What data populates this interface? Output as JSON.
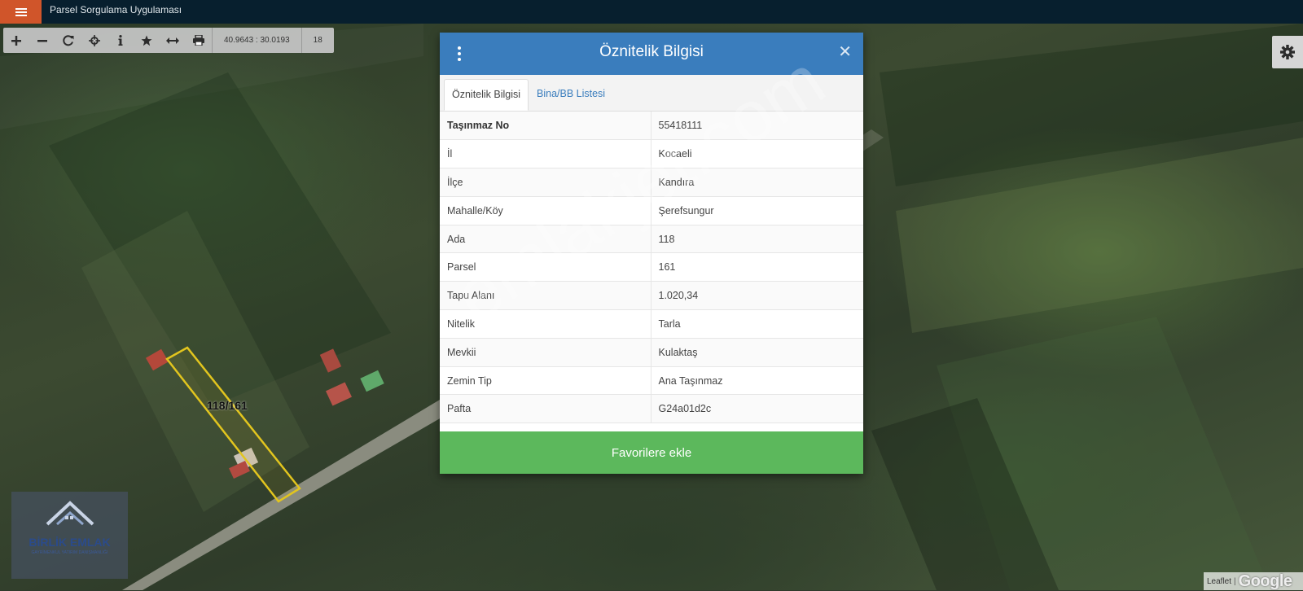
{
  "topbar": {
    "title": "Parsel Sorgulama Uygulaması"
  },
  "toolbar": {
    "tools": [
      "zoom-in-icon",
      "zoom-out-icon",
      "refresh-icon",
      "locate-icon",
      "info-icon",
      "star-icon",
      "measure-icon",
      "print-icon"
    ],
    "coordinates": "40.9643 : 30.0193",
    "zoom_level": "18"
  },
  "modal": {
    "title": "Öznitelik Bilgisi",
    "tabs": [
      {
        "label": "Öznitelik Bilgisi",
        "active": true
      },
      {
        "label": "Bina/BB Listesi",
        "active": false
      }
    ],
    "rows": [
      {
        "key": "Taşınmaz No",
        "value": "55418111"
      },
      {
        "key": "İl",
        "value": "Kocaeli"
      },
      {
        "key": "İlçe",
        "value": "Kandıra"
      },
      {
        "key": "Mahalle/Köy",
        "value": "Şerefsungur"
      },
      {
        "key": "Ada",
        "value": "118"
      },
      {
        "key": "Parsel",
        "value": "161"
      },
      {
        "key": "Tapu Alanı",
        "value": "1.020,34"
      },
      {
        "key": "Nitelik",
        "value": "Tarla"
      },
      {
        "key": "Mevkii",
        "value": "Kulaktaş"
      },
      {
        "key": "Zemin Tip",
        "value": "Ana Taşınmaz"
      },
      {
        "key": "Pafta",
        "value": "G24a01d2c"
      }
    ],
    "favorite_button": "Favorilere ekle"
  },
  "map": {
    "parcel_label": "118/161",
    "watermark": "emlakjet.com",
    "logo_text": "BİRLİK EMLAK",
    "logo_subtext": "GAYRİMENKUL YATIRIM DANIŞMANLIĞI",
    "attribution_leaflet": "Leaflet",
    "attribution_sep": "|",
    "attribution_google": "Google"
  },
  "colors": {
    "topbar": "#071f2e",
    "menu_button": "#d0552a",
    "modal_header": "#3a7dbd",
    "favorite_button": "#5cb85c",
    "parcel_outline": "#e2c51e"
  }
}
